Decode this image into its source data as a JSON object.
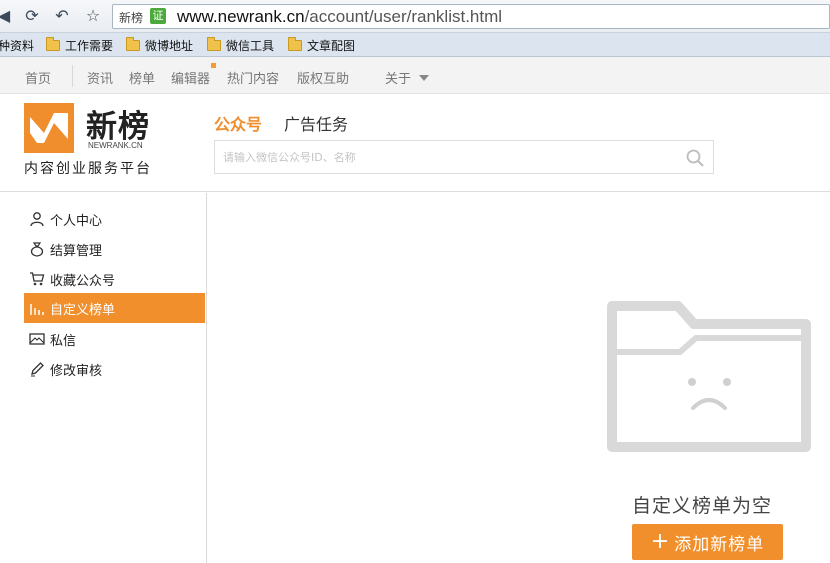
{
  "browser": {
    "site_tag": "新榜",
    "cert_label": "证",
    "url_host": "www.newrank.cn",
    "url_path": "/account/user/ranklist.html"
  },
  "bookmarks": [
    {
      "label": "种资料"
    },
    {
      "label": "工作需要"
    },
    {
      "label": "微博地址"
    },
    {
      "label": "微信工具"
    },
    {
      "label": "文章配图"
    }
  ],
  "site_nav": {
    "items": [
      "首页",
      "资讯",
      "榜单",
      "编辑器",
      "热门内容",
      "版权互助",
      "关于"
    ]
  },
  "header": {
    "logo_cn": "新榜",
    "logo_en": "NEWRANK.CN",
    "tagline": "内容创业服务平台",
    "tab_active": "公众号",
    "tab_other": "广告任务",
    "search_placeholder": "请输入微信公众号ID、名称"
  },
  "sidebar": {
    "items": [
      {
        "label": "个人中心",
        "icon": "user-icon"
      },
      {
        "label": "结算管理",
        "icon": "money-bag-icon"
      },
      {
        "label": "收藏公众号",
        "icon": "cart-icon"
      },
      {
        "label": "自定义榜单",
        "icon": "bar-chart-icon",
        "active": true
      },
      {
        "label": "私信",
        "icon": "mail-icon"
      },
      {
        "label": "修改审核",
        "icon": "pencil-icon"
      }
    ]
  },
  "empty_state": {
    "message": "自定义榜单为空",
    "button_label": "添加新榜单"
  },
  "colors": {
    "accent": "#f18f2d",
    "folder_gray": "#d9d9d9"
  }
}
